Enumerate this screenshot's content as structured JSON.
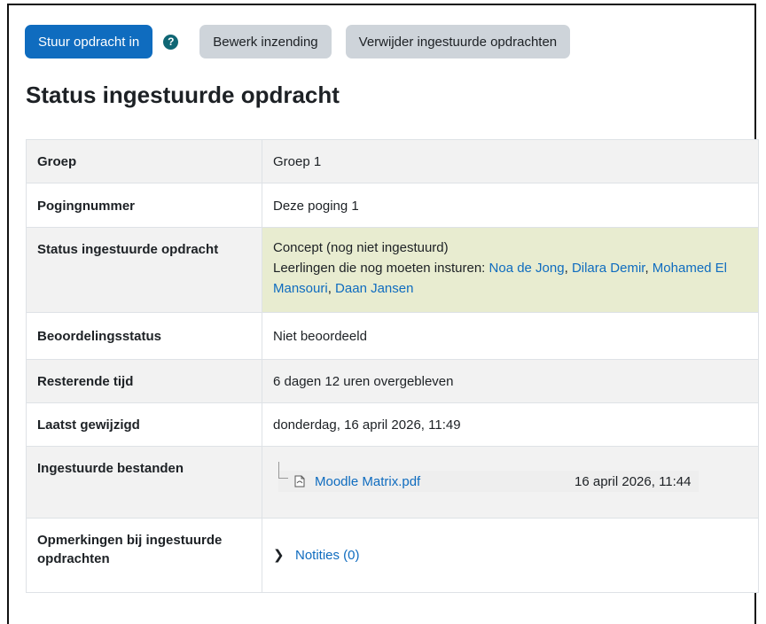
{
  "buttons": {
    "submit": "Stuur opdracht in",
    "edit": "Bewerk inzending",
    "remove": "Verwijder ingestuurde opdrachten",
    "help_glyph": "?"
  },
  "heading": "Status ingestuurde opdracht",
  "rows": {
    "group": {
      "label": "Groep",
      "value": "Groep 1"
    },
    "attempt": {
      "label": "Pogingnummer",
      "value": "Deze poging 1"
    },
    "status": {
      "label": "Status ingestuurde opdracht",
      "value": "Concept (nog niet ingestuurd)",
      "pending_prefix": "Leerlingen die nog moeten insturen:",
      "pending_students": [
        "Noa de Jong",
        "Dilara Demir",
        "Mohamed El Mansouri",
        "Daan Jansen"
      ]
    },
    "grading": {
      "label": "Beoordelingsstatus",
      "value": "Niet beoordeeld"
    },
    "time_remaining": {
      "label": "Resterende tijd",
      "value": "6 dagen 12 uren overgebleven"
    },
    "last_modified": {
      "label": "Laatst gewijzigd",
      "value": "donderdag, 16 april 2026, 11:49"
    },
    "files": {
      "label": "Ingestuurde bestanden",
      "file_name": "Moodle Matrix.pdf",
      "file_date": "16 april 2026, 11:44",
      "file_icon": "pdf-file-icon"
    },
    "comments": {
      "label": "Opmerkingen bij ingestuurde opdrachten",
      "link": "Notities (0)"
    }
  },
  "colors": {
    "primary": "#0f6cbf",
    "secondary": "#ced4da",
    "help": "#0f6674",
    "status_highlight": "#e8ecd0"
  }
}
